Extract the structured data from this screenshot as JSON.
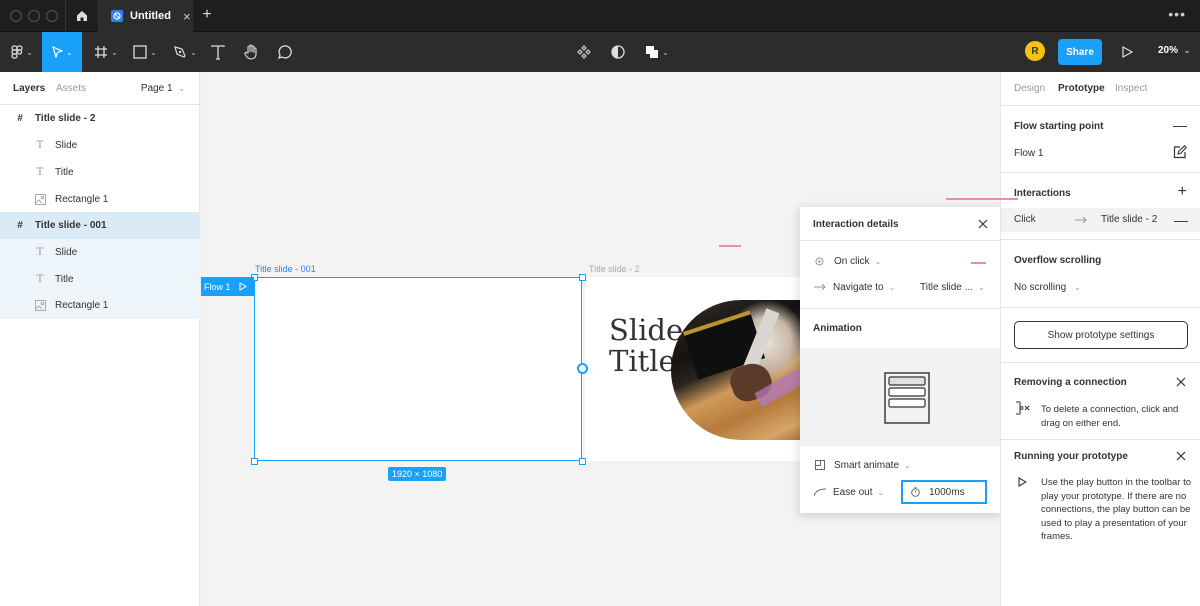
{
  "titlebar": {
    "file_tab": "Untitled",
    "close_glyph": "×",
    "new_tab_glyph": "+",
    "more_glyph": "•••"
  },
  "toolbar": {
    "tools": [
      "main-menu",
      "move",
      "frame",
      "shape",
      "pen",
      "text",
      "hand",
      "comment"
    ],
    "center_tools": [
      "components",
      "mask",
      "boolean"
    ],
    "avatar_initial": "R",
    "share_label": "Share",
    "zoom_level": "20%",
    "accent": "#18a0fb"
  },
  "left_panel": {
    "tabs": [
      "Layers",
      "Assets"
    ],
    "page": "Page 1",
    "layers": [
      {
        "label": "Title slide - 2",
        "type": "frame",
        "icon": "#"
      },
      {
        "label": "Slide",
        "type": "text",
        "icon": "T"
      },
      {
        "label": "Title",
        "type": "text",
        "icon": "T"
      },
      {
        "label": "Rectangle 1",
        "type": "image",
        "icon": "image"
      },
      {
        "label": "Title slide - 001",
        "type": "frame",
        "icon": "#",
        "selected": true
      },
      {
        "label": "Slide",
        "type": "text",
        "icon": "T"
      },
      {
        "label": "Title",
        "type": "text",
        "icon": "T"
      },
      {
        "label": "Rectangle 1",
        "type": "image",
        "icon": "image"
      }
    ]
  },
  "canvas": {
    "frame1_label": "Title slide - 001",
    "frame2_label": "Title slide - 2",
    "flow_tag": "Flow 1",
    "dimensions": "1920 × 1080",
    "slide_title_line1": "Slide",
    "slide_title_line2": "Title"
  },
  "interaction": {
    "title": "Interaction details",
    "trigger": "On click",
    "action": "Navigate to",
    "destination": "Title slide ...",
    "animation_header": "Animation",
    "animation_type": "Smart animate",
    "easing": "Ease out",
    "duration": "1000ms"
  },
  "right_panel": {
    "tabs": [
      "Design",
      "Prototype",
      "Inspect"
    ],
    "active_tab": "Prototype",
    "flow_start_header": "Flow starting point",
    "flow_name": "Flow 1",
    "interactions_header": "Interactions",
    "interaction_trigger": "Click",
    "interaction_target": "Title slide - 2",
    "overflow_header": "Overflow scrolling",
    "overflow_value": "No scrolling",
    "settings_button": "Show prototype settings",
    "removing_header": "Removing a connection",
    "removing_text": "To delete a connection, click and drag on either end.",
    "running_header": "Running your prototype",
    "running_text": "Use the play button in the toolbar to play your prototype. If there are no connections, the play button can be used to play a presentation of your frames."
  }
}
